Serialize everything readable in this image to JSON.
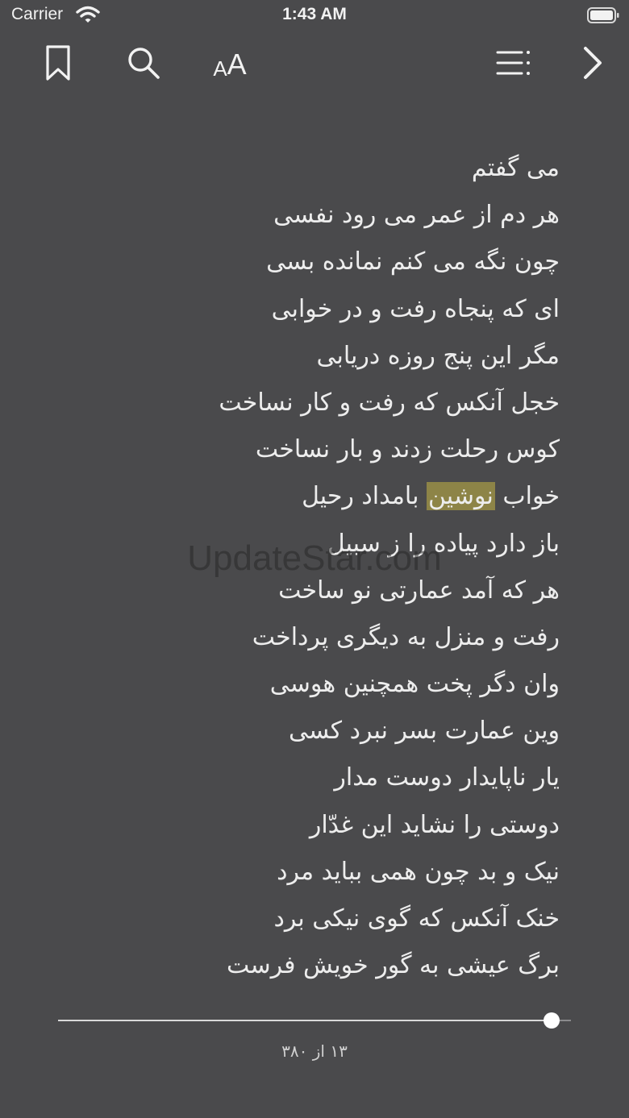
{
  "status_bar": {
    "carrier": "Carrier",
    "time": "1:43 AM",
    "wifi_icon": "wifi-icon",
    "battery_icon": "battery-icon"
  },
  "toolbar": {
    "bookmark_icon": "bookmark-icon",
    "search_icon": "search-icon",
    "font_size_small": "A",
    "font_size_large": "A",
    "toc_icon": "list-icon",
    "next_icon": "chevron-right-icon"
  },
  "poem": {
    "highlight_color": "#8d8447",
    "lines": [
      {
        "text": "می گفتم"
      },
      {
        "text": "هر دم از عمر می رود نفسی"
      },
      {
        "text": "چون نگه می کنم نمانده بسی"
      },
      {
        "text": "ای که پنجاه رفت و در خوابی"
      },
      {
        "text": "مگر این پنج روزه دریابی"
      },
      {
        "text": "خجل آنکس که رفت و کار نساخت"
      },
      {
        "text": "کوس رحلت زدند و بار نساخت"
      },
      {
        "before": "خواب ",
        "highlight": "نوشین",
        "after": " بامداد رحیل"
      },
      {
        "text": "باز دارد پیاده را ز سبیل"
      },
      {
        "text": "هر که آمد عمارتی نو ساخت"
      },
      {
        "text": "رفت و منزل به دیگری پرداخت"
      },
      {
        "text": "وان دگر پخت همچنین هوسی"
      },
      {
        "text": "وین عمارت بسر نبرد کسی"
      },
      {
        "text": "یار ناپایدار دوست مدار"
      },
      {
        "text": "دوستی را نشاید این غدّار"
      },
      {
        "text": "نیک و بد چون همی بباید مرد"
      },
      {
        "text": "خنک آنکس که گوی نیکی برد"
      },
      {
        "text": "برگ عیشی به گور خویش فرست"
      }
    ]
  },
  "watermark": "UpdateStar.com",
  "progress": {
    "fraction": 0.962,
    "label": "۱۳ از ۳۸۰"
  }
}
